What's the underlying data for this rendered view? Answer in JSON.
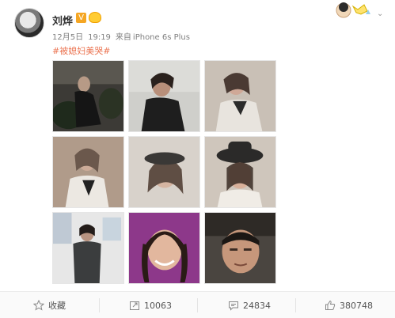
{
  "user": {
    "name": "刘烨"
  },
  "meta": {
    "date": "12月5日",
    "time": "19:19",
    "source_prefix": "来自",
    "source": "iPhone 6s Plus"
  },
  "post": {
    "hashtag": "#被媳妇美哭#"
  },
  "photos": [
    {
      "label": "photo-1"
    },
    {
      "label": "photo-2"
    },
    {
      "label": "photo-3"
    },
    {
      "label": "photo-4"
    },
    {
      "label": "photo-5"
    },
    {
      "label": "photo-6"
    },
    {
      "label": "photo-7"
    },
    {
      "label": "photo-8"
    },
    {
      "label": "photo-9"
    }
  ],
  "actions": {
    "favorite_label": "收藏",
    "repost_count": "10063",
    "comment_count": "24834",
    "like_count": "380748"
  },
  "colors": {
    "hashtag": "#eb7350",
    "meta": "#808080",
    "username": "#333333"
  }
}
